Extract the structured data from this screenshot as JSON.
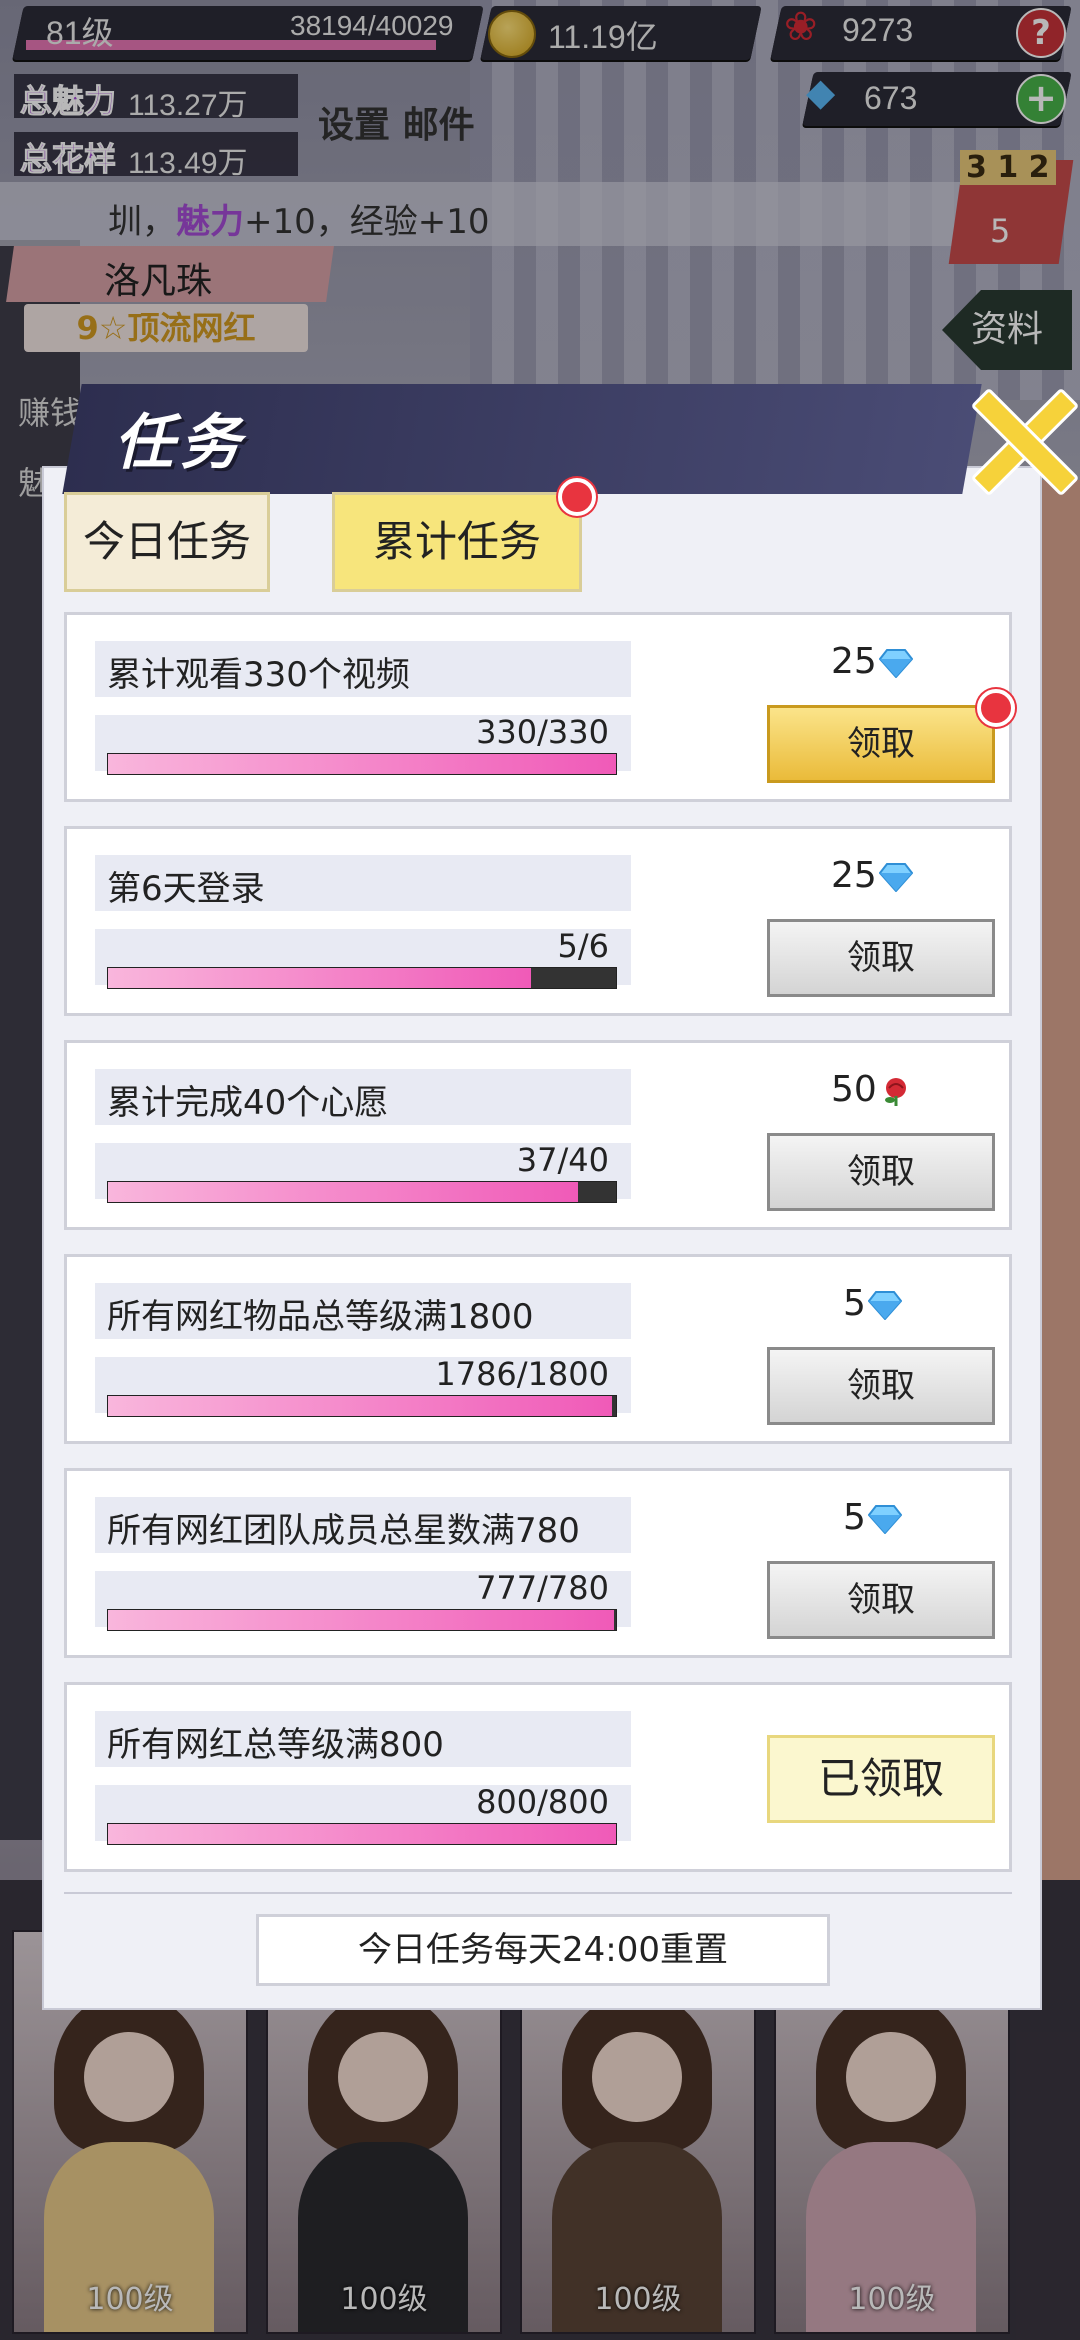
{
  "hud": {
    "level": "81级",
    "exp": "38194/40029",
    "exp_progress": 0.954,
    "coins": "11.19亿",
    "roses": "9273",
    "diamonds": "673",
    "help": "?",
    "add": "+",
    "charm_label": "总魅力",
    "charm_value": "113.27万",
    "style_label": "总花样",
    "style_value": "113.49万",
    "settings": "设置",
    "mail": "邮件",
    "rank_podium": "3 1 2",
    "rank_num": "5",
    "profile": "资料"
  },
  "announcement": {
    "prefix": "圳，",
    "charm": "魅力",
    "rest": "+10，经验+10"
  },
  "character": {
    "name": "洛凡珠",
    "title": "9☆顶流网红",
    "side_a": "赚钱",
    "side_b": "魅"
  },
  "dialog": {
    "title": "任务",
    "tabs": [
      {
        "label": "今日任务"
      },
      {
        "label": "累计任务"
      }
    ],
    "tasks": [
      {
        "title": "累计观看330个视频",
        "progress_text": "330/330",
        "progress": 1.0,
        "reward_amount": "25",
        "reward_type": "diamond",
        "button": "领取",
        "button_style": "gold",
        "dot": true
      },
      {
        "title": "第6天登录",
        "progress_text": "5/6",
        "progress": 0.833,
        "reward_amount": "25",
        "reward_type": "diamond",
        "button": "领取",
        "button_style": "grey",
        "dot": false
      },
      {
        "title": "累计完成40个心愿",
        "progress_text": "37/40",
        "progress": 0.925,
        "reward_amount": "50",
        "reward_type": "rose",
        "button": "领取",
        "button_style": "grey",
        "dot": false
      },
      {
        "title": "所有网红物品总等级满1800",
        "progress_text": "1786/1800",
        "progress": 0.992,
        "reward_amount": "5",
        "reward_type": "diamond",
        "button": "领取",
        "button_style": "grey",
        "dot": false
      },
      {
        "title": "所有网红团队成员总星数满780",
        "progress_text": "777/780",
        "progress": 0.996,
        "reward_amount": "5",
        "reward_type": "diamond",
        "button": "领取",
        "button_style": "grey",
        "dot": false
      },
      {
        "title": "所有网红总等级满800",
        "progress_text": "800/800",
        "progress": 1.0,
        "reward_amount": "",
        "reward_type": "",
        "button": "已领取",
        "button_style": "claimed",
        "dot": false
      }
    ],
    "reset_note": "今日任务每天24:00重置"
  },
  "gallery": [
    {
      "level": "100级",
      "color": "#e8c98a"
    },
    {
      "level": "100级",
      "color": "#2a2a2e"
    },
    {
      "level": "100级",
      "color": "#5a4436"
    },
    {
      "level": "100级",
      "color": "#cfa7b3"
    }
  ],
  "colors": {
    "accent_gold": "#f7e57c",
    "progress_pink": "#f05ab8",
    "diamond": "#5ab8f5",
    "rose": "#d42a35",
    "red_dot": "#e8343f"
  }
}
